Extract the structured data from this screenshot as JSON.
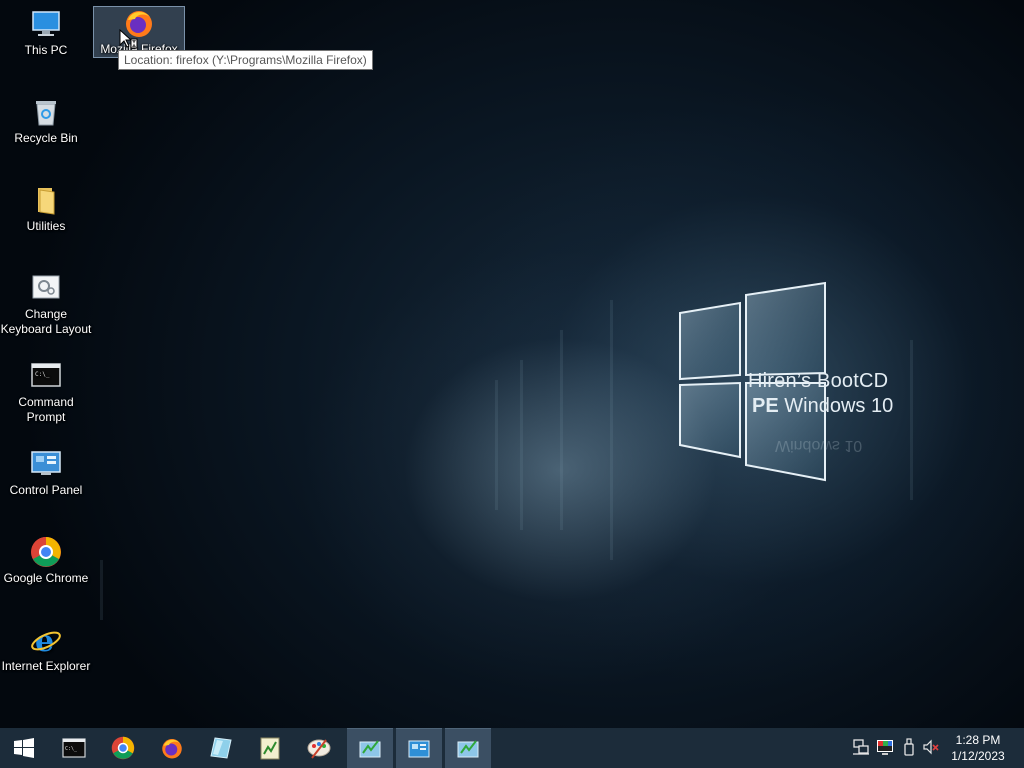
{
  "desktop": {
    "icons": [
      {
        "label": "This PC",
        "icon": "computer-icon"
      },
      {
        "label": "Mozilla Firefox",
        "icon": "firefox-icon"
      },
      {
        "label": "Recycle Bin",
        "icon": "recycle-bin-icon"
      },
      {
        "label": "Utilities",
        "icon": "folder-icon"
      },
      {
        "label": "Change Keyboard Layout",
        "icon": "keyboard-settings-icon"
      },
      {
        "label": "Command Prompt",
        "icon": "command-prompt-icon"
      },
      {
        "label": "Control Panel",
        "icon": "control-panel-icon"
      },
      {
        "label": "Google Chrome",
        "icon": "chrome-icon"
      },
      {
        "label": "Internet Explorer",
        "icon": "internet-explorer-icon"
      }
    ],
    "tooltip": "Location: firefox (Y:\\Programs\\Mozilla Firefox)"
  },
  "wallpaper": {
    "line1": "Hiren’s BootCD",
    "line2_bold": "PE",
    "line2_rest": "Windows 10",
    "reflection": "Windows 10"
  },
  "taskbar": {
    "buttons": [
      {
        "icon": "start-windows-icon"
      },
      {
        "icon": "command-prompt-icon"
      },
      {
        "icon": "chrome-icon"
      },
      {
        "icon": "firefox-icon"
      },
      {
        "icon": "glass-app-icon"
      },
      {
        "icon": "notepad-chart-icon"
      },
      {
        "icon": "paint-app-icon"
      },
      {
        "icon": "running-window-icon",
        "active": true
      },
      {
        "icon": "running-window-icon",
        "active": true
      },
      {
        "icon": "running-window-icon",
        "active": true
      }
    ],
    "tray": {
      "icons": [
        "network-icon",
        "display-icon",
        "usb-drive-icon",
        "volume-muted-icon"
      ],
      "time": "1:28 PM",
      "date": "1/12/2023"
    }
  },
  "colors": {
    "taskbar": "#1c2c3a",
    "active_task": "#3b4f63",
    "tooltip_border": "#767676"
  }
}
